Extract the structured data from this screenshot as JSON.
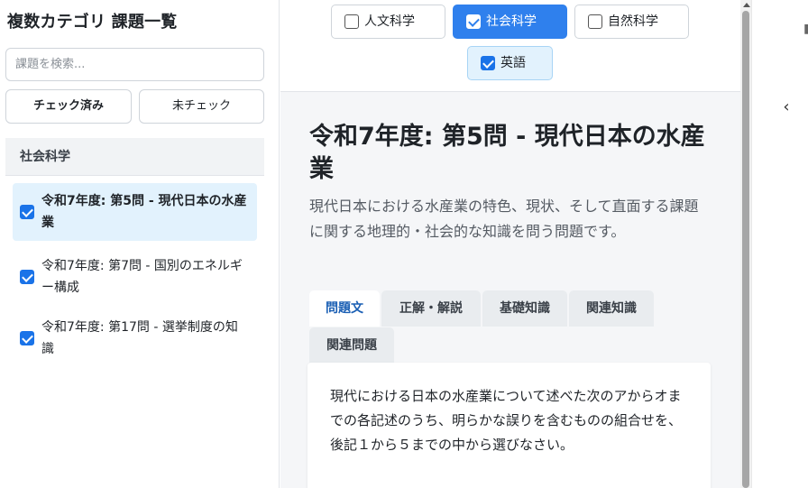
{
  "sidebar": {
    "title": "複数カテゴリ 課題一覧",
    "search_placeholder": "課題を検索...",
    "filter_checked": "チェック済み",
    "filter_unchecked": "未チェック",
    "group_label": "社会科学",
    "items": [
      {
        "label": "令和7年度: 第5問 - 現代日本の水産業",
        "checked": true,
        "active": true
      },
      {
        "label": "令和7年度: 第7問 - 国別のエネルギー構成",
        "checked": true,
        "active": false
      },
      {
        "label": "令和7年度: 第17問 - 選挙制度の知識",
        "checked": true,
        "active": false
      }
    ]
  },
  "categories": [
    {
      "label": "人文科学",
      "checked": false
    },
    {
      "label": "社会科学",
      "checked": true
    },
    {
      "label": "自然科学",
      "checked": false
    },
    {
      "label": "英語",
      "checked": true
    }
  ],
  "problem": {
    "title": "令和7年度: 第5問 - 現代日本の水産業",
    "description": "現代日本における水産業の特色、現状、そして直面する課題に関する地理的・社会的な知識を問う問題です。",
    "tabs": [
      "問題文",
      "正解・解説",
      "基礎知識",
      "関連知識",
      "関連問題"
    ],
    "active_tab": "問題文",
    "question_text": "現代における日本の水産業について述べた次のアからオまでの各記述のうち、明らかな誤りを含むものの組合せを、後記１から５までの中から選びなさい。"
  },
  "right_panel": {
    "collapse_icon": "chevron-left-icon"
  },
  "colors": {
    "accent": "#2f80ed",
    "active_item_bg": "#e2f2fd",
    "main_bg": "#f5f6f8"
  }
}
